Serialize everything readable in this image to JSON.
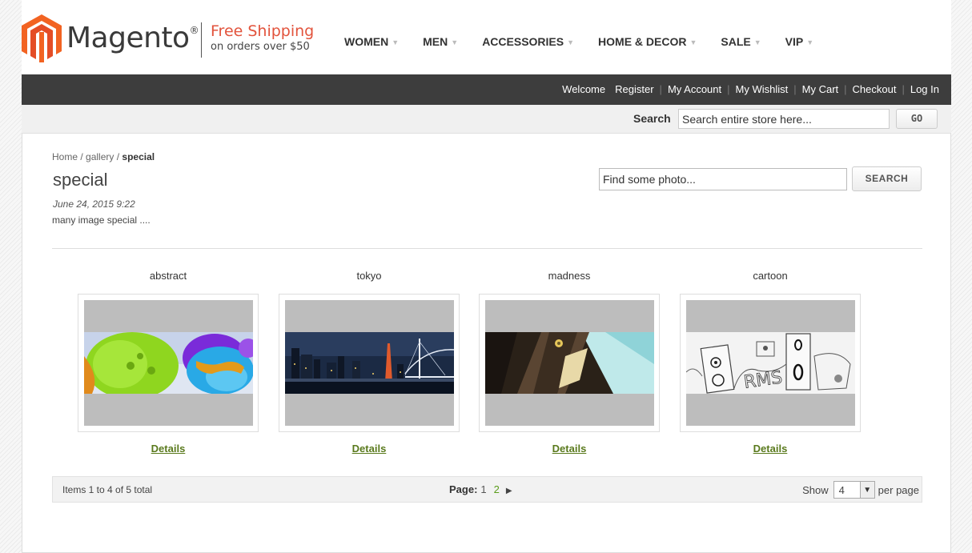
{
  "brand": {
    "name": "Magento",
    "reg_mark": "®",
    "color": "#f26322"
  },
  "promo": {
    "line1": "Free Shipping",
    "line2": "on orders over $50"
  },
  "nav": {
    "items": [
      "WOMEN",
      "MEN",
      "ACCESSORIES",
      "HOME & DECOR",
      "SALE",
      "VIP"
    ]
  },
  "toplinks": {
    "welcome": "Welcome",
    "links": [
      "Register",
      "My Account",
      "My Wishlist",
      "My Cart",
      "Checkout",
      "Log In"
    ]
  },
  "search": {
    "label": "Search",
    "value": "Search entire store here...",
    "button": "GO"
  },
  "breadcrumb": {
    "home": "Home",
    "sep1": " / ",
    "gallery": "gallery",
    "sep2": " / ",
    "current": "special"
  },
  "post": {
    "title": "special",
    "date": "June 24, 2015 9:22",
    "description": "many image special ...."
  },
  "photo_search": {
    "value": "Find some photo...",
    "button": "SEARCH"
  },
  "gallery": {
    "details_label": "Details",
    "items": [
      {
        "title": "abstract",
        "icon": "abstract-3d-image"
      },
      {
        "title": "tokyo",
        "icon": "city-bridge-night-image"
      },
      {
        "title": "madness",
        "icon": "madness-photo-image"
      },
      {
        "title": "cartoon",
        "icon": "cartoon-speakers-sketch-image"
      }
    ]
  },
  "pager": {
    "count_text": "Items 1 to 4 of 5 total",
    "page_label": "Page:",
    "current_page": "1",
    "next_page": "2",
    "next_arrow": "▶",
    "show_label": "Show",
    "per_page_value": "4",
    "per_page_suffix": "per page"
  },
  "colors": {
    "topbar": "#3d3d3d",
    "promo": "#e2533c",
    "link_green": "#5a7a1d",
    "page_link": "#5a9c1a"
  }
}
